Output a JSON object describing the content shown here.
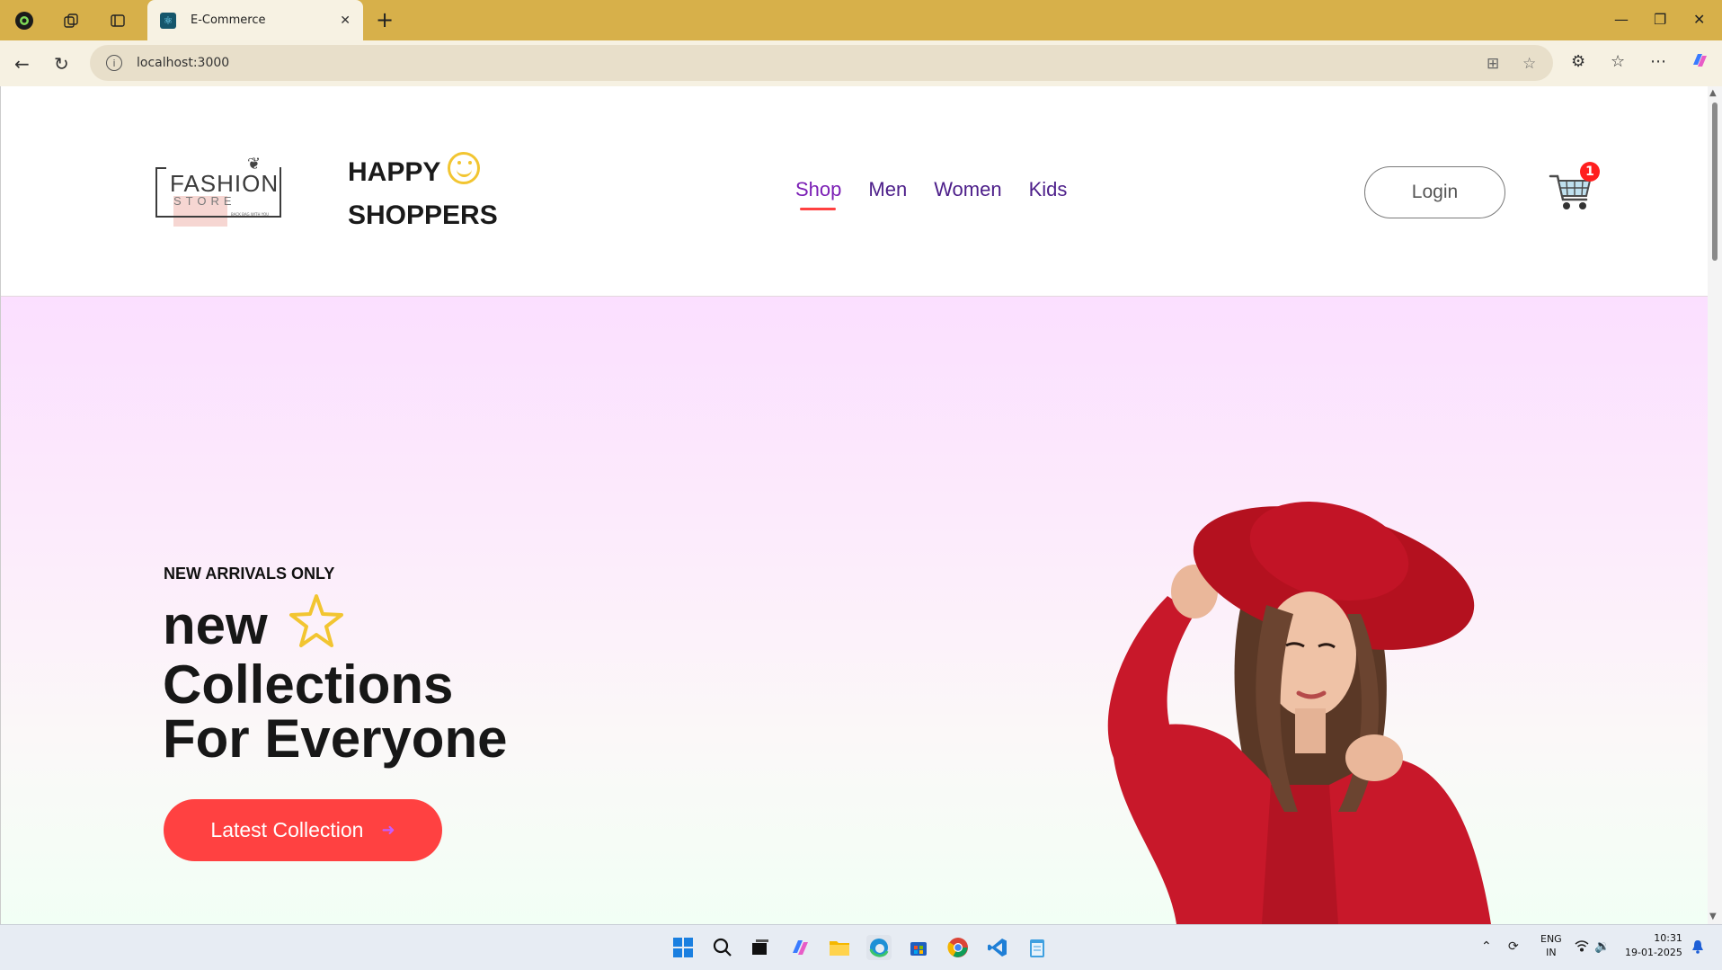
{
  "browser": {
    "tab_title": "E-Commerce",
    "url": "localhost:3000"
  },
  "site": {
    "logo_word1": "FASHION",
    "logo_word2": "STORE",
    "logo_tagline": "BACK BAG WITH YOU",
    "brand_line1": "HAPPY",
    "brand_line2": "SHOPPERS",
    "menu": [
      {
        "label": "Shop",
        "active": true
      },
      {
        "label": "Men",
        "active": false
      },
      {
        "label": "Women",
        "active": false
      },
      {
        "label": "Kids",
        "active": false
      }
    ],
    "login_label": "Login",
    "cart_count": "1"
  },
  "hero": {
    "kicker": "NEW ARRIVALS ONLY",
    "line1": "new",
    "line2": "Collections",
    "line3": "For Everyone",
    "cta_label": "Latest Collection"
  },
  "taskbar": {
    "lang_line1": "ENG",
    "lang_line2": "IN",
    "time": "10:31",
    "date": "19-01-2025"
  },
  "colors": {
    "accent_red": "#ff4141",
    "menu_purple": "#4d1f8a",
    "star_yellow": "#f2c531"
  }
}
